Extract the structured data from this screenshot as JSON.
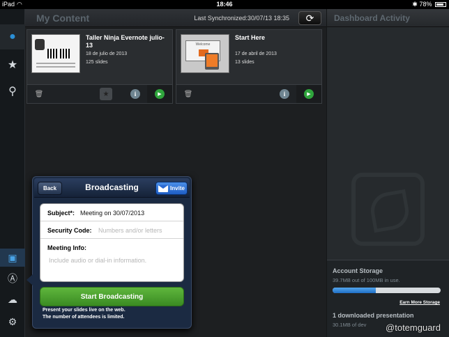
{
  "status_bar": {
    "device": "iPad",
    "time": "18:46",
    "battery": "78%"
  },
  "main": {
    "title": "My Content",
    "last_sync": "Last Synchronized:30/07/13 18:35"
  },
  "cards": [
    {
      "title": "Taller Ninja Evernote julio-13",
      "date": "18 de julio de 2013",
      "slides": "125 slides"
    },
    {
      "title": "Start Here",
      "date": "17 de abril de 2013",
      "slides": "13 slides",
      "thumb_text": "Welcome"
    }
  ],
  "broadcast": {
    "back_label": "Back",
    "title": "Broadcasting",
    "invite_label": "Invite",
    "subject_label": "Subject*:",
    "subject_value": "Meeting on 30/07/2013",
    "security_label": "Security Code:",
    "security_placeholder": "Numbers and/or letters",
    "meeting_info_label": "Meeting Info:",
    "meeting_info_placeholder": "Include audio or dial-in information.",
    "start_label": "Start Broadcasting",
    "note_line1": "Present your slides live on the web.",
    "note_line2": "The number of attendees is limited."
  },
  "dashboard": {
    "title": "Dashboard Activity",
    "storage_title": "Account Storage",
    "storage_detail": "39.7MB out of 100MB in use.",
    "storage_fraction": 0.397,
    "earn_more": "Earn More Storage",
    "downloaded_title": "1 downloaded presentation",
    "downloaded_detail": "30.1MB of dev"
  },
  "watermark": "@totemguard",
  "colors": {
    "accent_blue": "#2b8fd5",
    "start_green": "#3a8b22",
    "play_green": "#2fa53c"
  }
}
